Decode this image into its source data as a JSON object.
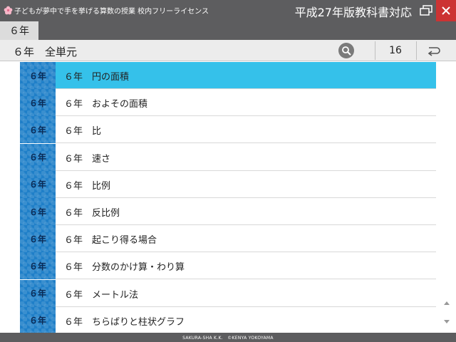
{
  "window": {
    "title": "子どもが夢中で手を挙げる算数の授業 校内フリーライセンス",
    "edition": "平成27年版教科書対応"
  },
  "tabs": {
    "grade_tab": "６年"
  },
  "header": {
    "title": "６年　全単元",
    "count": "16"
  },
  "list": {
    "items": [
      {
        "badge": "６年",
        "label": "６年　円の面積",
        "selected": true
      },
      {
        "badge": "６年",
        "label": "６年　およその面積",
        "selected": false
      },
      {
        "badge": "６年",
        "label": "６年　比",
        "selected": false
      },
      {
        "badge": "６年",
        "label": "６年　速さ",
        "selected": false
      },
      {
        "badge": "６年",
        "label": "６年　比例",
        "selected": false
      },
      {
        "badge": "６年",
        "label": "６年　反比例",
        "selected": false
      },
      {
        "badge": "６年",
        "label": "６年　起こり得る場合",
        "selected": false
      },
      {
        "badge": "６年",
        "label": "６年　分数のかけ算・わり算",
        "selected": false
      },
      {
        "badge": "６年",
        "label": "６年　メートル法",
        "selected": false
      },
      {
        "badge": "６年",
        "label": "６年　ちらばりと柱状グラフ",
        "selected": false
      }
    ]
  },
  "footer": {
    "credit": "SAKURA-SHA K.K.　©KENYA YOKOYAMA"
  },
  "colors": {
    "selected_row": "#35c1ea",
    "badge": "#1f7fc8",
    "titlebar": "#5d5d5f",
    "close": "#cc3333"
  },
  "icons": [
    "sakura-logo-icon",
    "restore-window-icon",
    "close-icon",
    "search-icon",
    "return-arrow-icon",
    "scroll-up-icon",
    "scroll-down-icon"
  ]
}
